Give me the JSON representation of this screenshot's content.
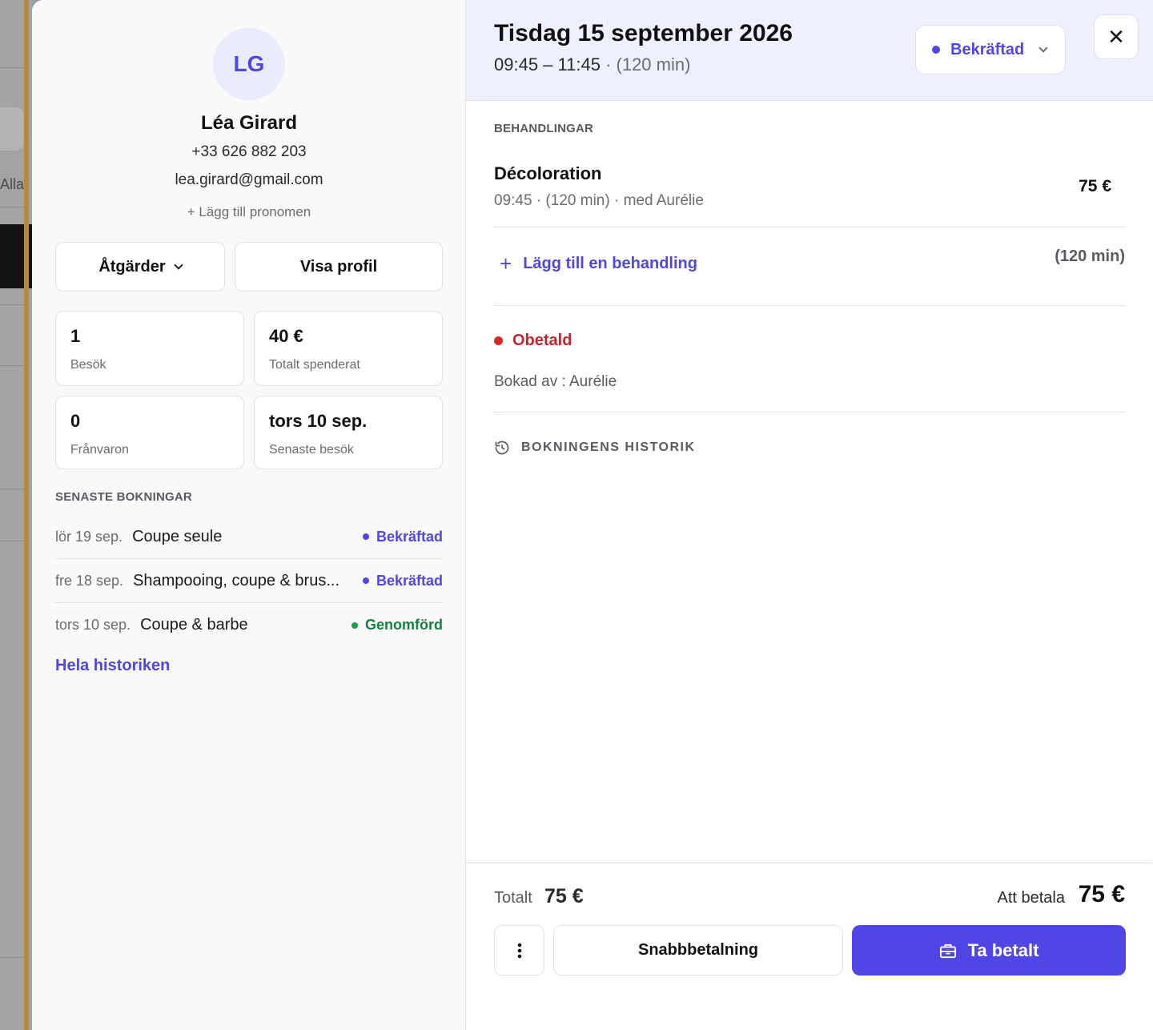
{
  "background": {
    "tab_label": "Alla"
  },
  "client": {
    "initials": "LG",
    "name": "Léa Girard",
    "phone": "+33 626 882 203",
    "email": "lea.girard@gmail.com",
    "add_pronoun": "+ Lägg till pronomen",
    "actions_label": "Åtgärder",
    "view_profile_label": "Visa profil",
    "stats": [
      {
        "value": "1",
        "label": "Besök"
      },
      {
        "value": "40 €",
        "label": "Totalt spenderat"
      },
      {
        "value": "0",
        "label": "Frånvaron"
      },
      {
        "value": "tors 10 sep.",
        "label": "Senaste besök"
      }
    ],
    "recent_title": "SENASTE BOKNINGAR",
    "recent": [
      {
        "date": "lör 19 sep.",
        "service": "Coupe seule",
        "status": "Bekräftad"
      },
      {
        "date": "fre 18 sep.",
        "service": "Shampooing, coupe & brus...",
        "status": "Bekräftad"
      },
      {
        "date": "tors 10 sep.",
        "service": "Coupe & barbe",
        "status": "Genomförd"
      }
    ],
    "all_history": "Hela historiken"
  },
  "booking": {
    "date_title": "Tisdag 15 september 2026",
    "time_range": "09:45 – 11:45",
    "duration": "· (120 min)",
    "status": "Bekräftad",
    "treatments_title": "BEHANDLINGAR",
    "treatment": {
      "name": "Décoloration",
      "meta": "09:45 · (120 min) · med Aurélie",
      "price": "75 €"
    },
    "add_treatment": "Lägg till en behandling",
    "total_duration": "(120 min)",
    "payment_status": "Obetald",
    "booked_by": "Bokad av : Aurélie",
    "history_title": "BOKNINGENS HISTORIK"
  },
  "footer": {
    "total_label": "Totalt",
    "total_value": "75 €",
    "due_label": "Att betala",
    "due_value": "75 €",
    "quick_pay_label": "Snabbbetalning",
    "pay_label": "Ta betalt"
  },
  "colors": {
    "accent": "#4f46e5",
    "unpaid": "#dc2626",
    "completed": "#16a34a"
  }
}
